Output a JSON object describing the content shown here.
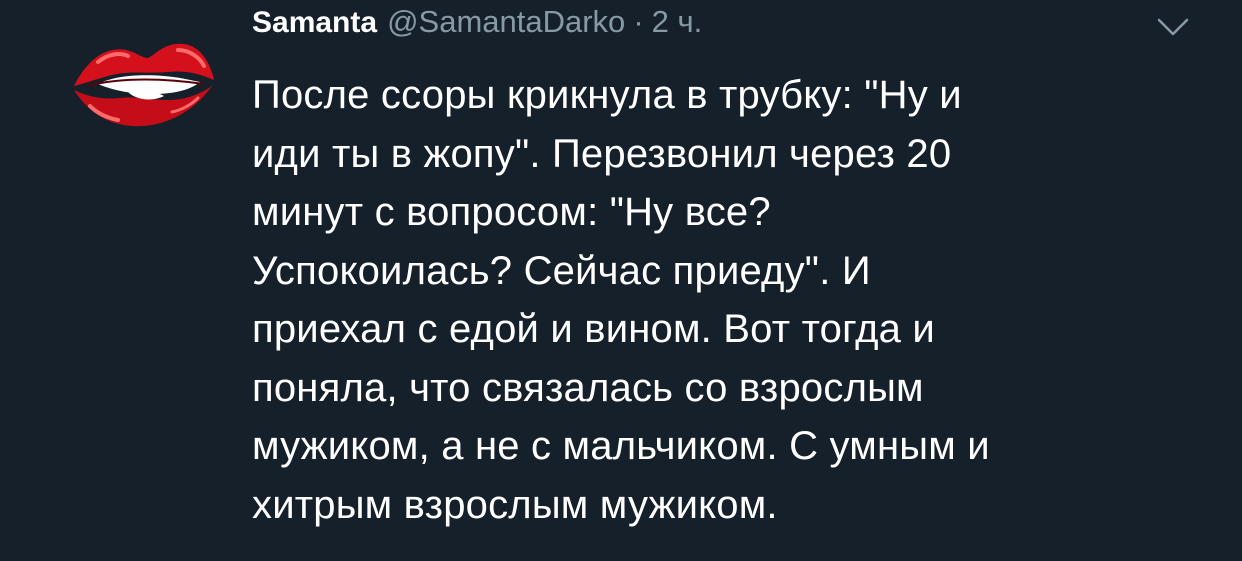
{
  "tweet": {
    "display_name": "Samanta",
    "handle": "@SamantaDarko",
    "separator": "·",
    "time": "2 ч.",
    "avatar_icon": "red-lips-icon",
    "menu_icon": "chevron-down-icon",
    "text_lines": [
      "После ссоры крикнула в трубку: \"Ну и",
      "иди ты в жопу\". Перезвонил через 20",
      "минут с вопросом: \"Ну все?",
      "Успокоилась? Сейчас приеду\". И",
      "приехал с едой и вином. Вот тогда и",
      "поняла, что связалась со взрослым",
      "мужиком, а не с мальчиком. С умным и",
      "хитрым взрослым мужиком."
    ]
  },
  "colors": {
    "background": "#15202b",
    "text": "#ffffff",
    "secondary_text": "#8899a6",
    "lips_red": "#d4101c"
  }
}
